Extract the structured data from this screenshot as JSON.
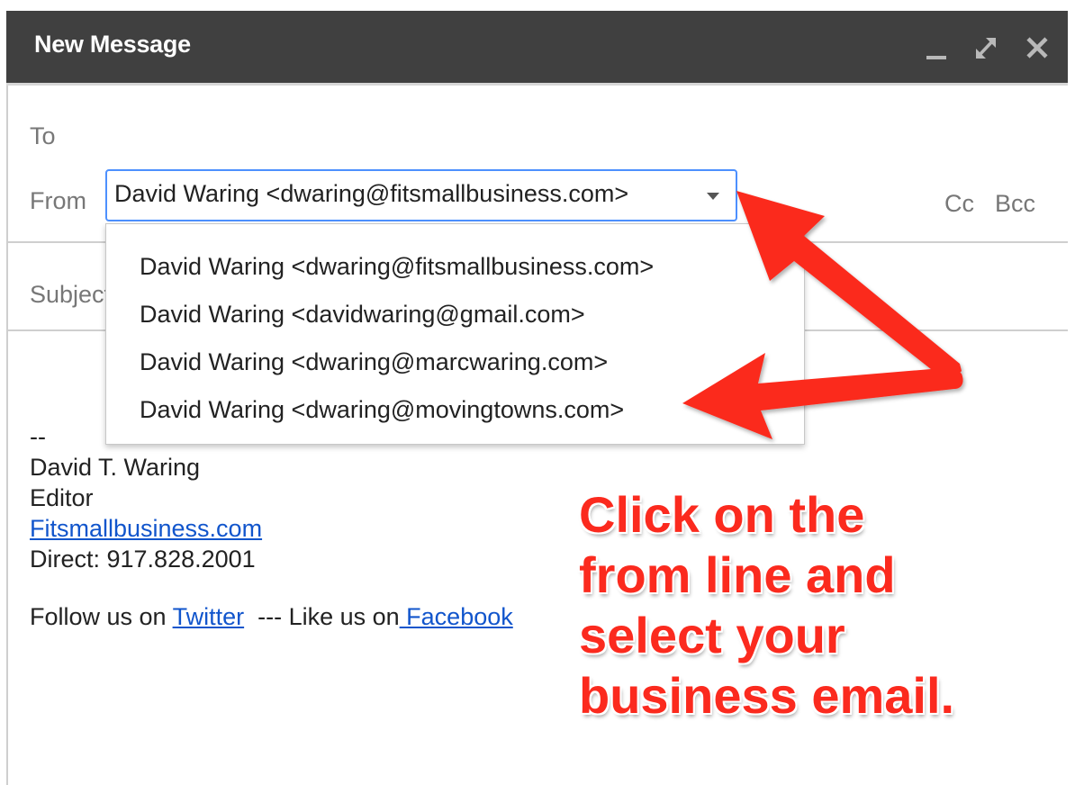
{
  "window": {
    "title": "New Message",
    "controls": {
      "minimize_icon": "minimize-icon",
      "expand_icon": "expand-icon",
      "close_icon": "close-icon"
    }
  },
  "compose": {
    "to_label": "To",
    "to_value": "",
    "from_label": "From",
    "from_value": "David Waring <dwaring@fitsmallbusiness.com>",
    "cc_label": "Cc",
    "bcc_label": "Bcc",
    "subject_label": "Subject",
    "subject_value": "",
    "from_options": [
      "David Waring <dwaring@fitsmallbusiness.com>",
      "David Waring <davidwaring@gmail.com>",
      "David Waring <dwaring@marcwaring.com>",
      "David Waring <dwaring@movingtowns.com>"
    ]
  },
  "signature": {
    "separator": "--",
    "name": "David T. Waring",
    "role": "Editor",
    "website": "Fitsmallbusiness.com",
    "phone": "Direct: 917.828.2001",
    "follow_prefix": "Follow us on ",
    "twitter_label": "Twitter",
    "follow_middle": "  --- Like us on",
    "facebook_label": " Facebook"
  },
  "annotation": {
    "lines": [
      "Click on the",
      "from line and",
      "select your",
      "business email."
    ],
    "color": "#fb2a1e"
  },
  "colors": {
    "titlebar": "#404040",
    "focus_border": "#4d90fe",
    "link": "#1155cc",
    "arrow": "#fb2a1e"
  }
}
